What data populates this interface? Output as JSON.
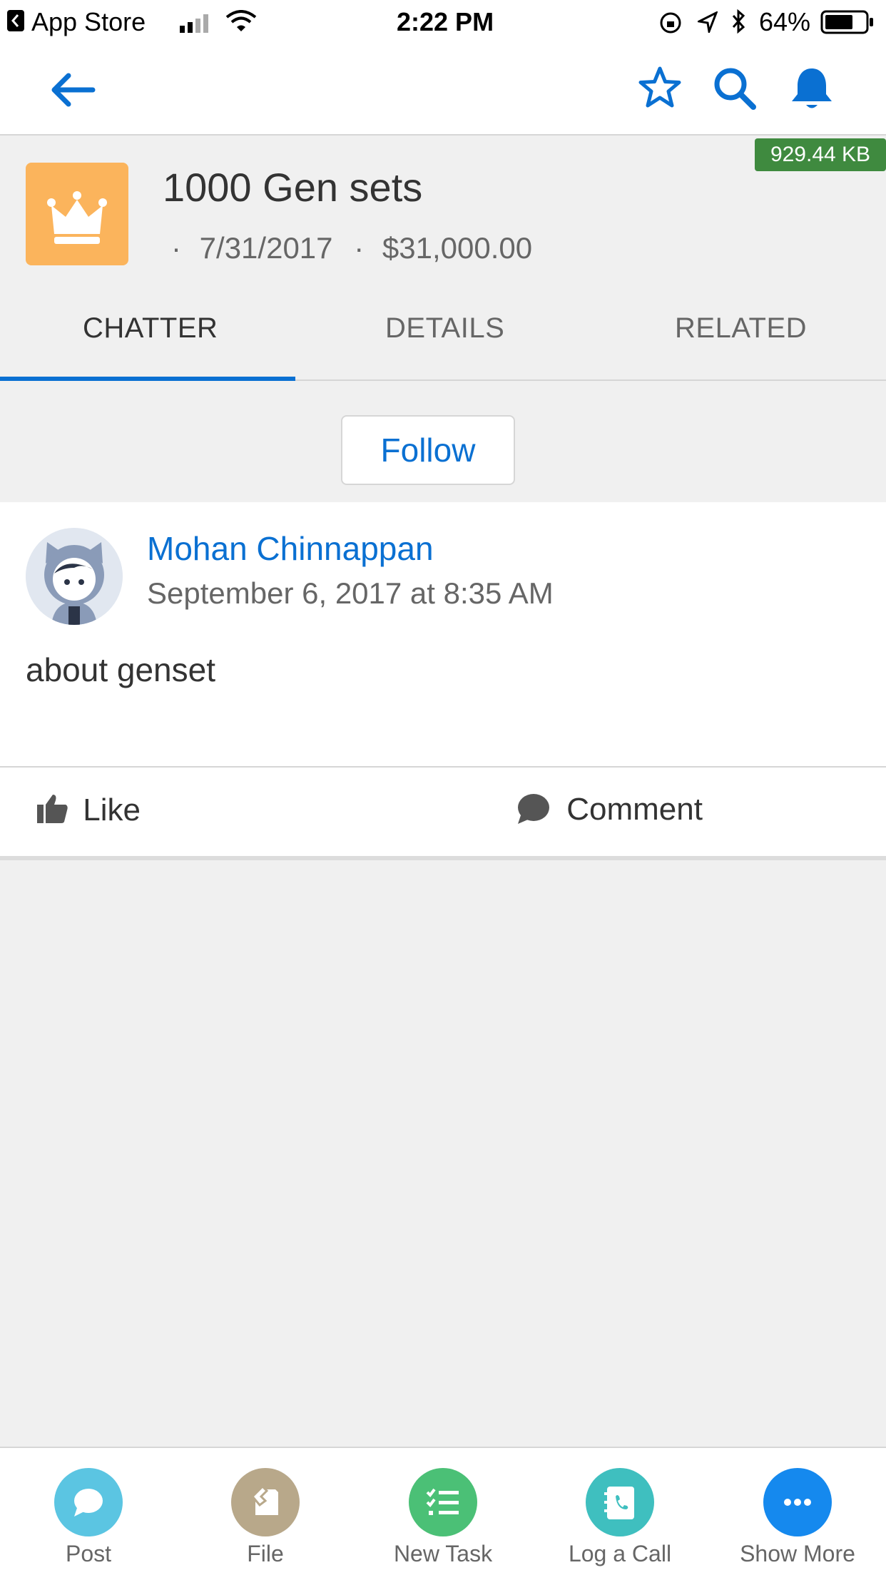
{
  "status_bar": {
    "back_app": "App Store",
    "time": "2:22 PM",
    "battery": "64%"
  },
  "nav": {
    "back_icon": "back-arrow-icon",
    "favorite_icon": "star-icon",
    "search_icon": "search-icon",
    "notifications_icon": "bell-icon"
  },
  "badge": {
    "size": "929.44 KB"
  },
  "record": {
    "title": "1000 Gen sets",
    "close_date": "7/31/2017",
    "amount": "$31,000.00",
    "icon": "crown-icon",
    "icon_color": "#fbb45c"
  },
  "tabs": [
    {
      "label": "CHATTER",
      "active": true
    },
    {
      "label": "DETAILS",
      "active": false
    },
    {
      "label": "RELATED",
      "active": false
    }
  ],
  "follow_label": "Follow",
  "post": {
    "author": "Mohan Chinnappan",
    "timestamp": "September 6, 2017 at 8:35 AM",
    "body": "about genset",
    "like_label": "Like",
    "comment_label": "Comment"
  },
  "actions": [
    {
      "label": "Post",
      "color": "#5bc5e2",
      "icon": "chat-bubble-icon"
    },
    {
      "label": "File",
      "color": "#b8a88a",
      "icon": "file-icon"
    },
    {
      "label": "New Task",
      "color": "#4bc076",
      "icon": "checklist-icon"
    },
    {
      "label": "Log a Call",
      "color": "#3fbfbf",
      "icon": "phone-book-icon"
    },
    {
      "label": "Show More",
      "color": "#1589ee",
      "icon": "ellipsis-icon"
    }
  ],
  "colors": {
    "brand": "#0a70d2",
    "badge": "#3f8a3f"
  }
}
